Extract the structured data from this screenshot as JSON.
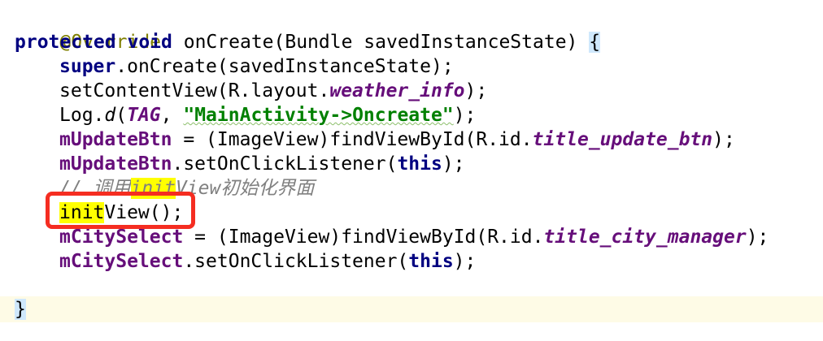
{
  "code": {
    "l1": {
      "annotation": "@Override"
    },
    "l2": {
      "kw_protected": "protected",
      "kw_void": "void",
      "signature": "onCreate(Bundle savedInstanceState)",
      "open_brace": "{"
    },
    "l3": {
      "kw_super": "super",
      "rest": ".onCreate(savedInstanceState);"
    },
    "l4": {
      "pre": "setContentView(R.layout.",
      "field": "weather_info",
      "post": ");"
    },
    "l5": {
      "pre": "Log.",
      "method": "d",
      "paren": "(",
      "tag": "TAG",
      "comma": ", ",
      "string": "\"MainActivity->Oncreate\"",
      "post": ");"
    },
    "l6": {
      "field": "mUpdateBtn",
      "mid": " = (ImageView)findViewById(R.id.",
      "id": "title_update_btn",
      "post": ");"
    },
    "l7": {
      "field": "mUpdateBtn",
      "mid": ".setOnClickListener(",
      "kw_this": "this",
      "post": ");"
    },
    "l8": {
      "comment_pre": "// 调用",
      "comment_hl": "init",
      "comment_post": "View初始化界面"
    },
    "l9": {
      "hl": "init",
      "rest": "View();"
    },
    "l10": {
      "field": "mCitySelect",
      "mid": " = (ImageView)findViewById(R.id.",
      "id": "title_city_manager",
      "post": ");"
    },
    "l11": {
      "field": "mCitySelect",
      "mid": ".setOnClickListener(",
      "kw_this": "this",
      "post": ");"
    },
    "l13": {
      "close_brace": "}"
    }
  },
  "colors": {
    "keyword": "#000080",
    "field": "#660e7a",
    "string": "#008000",
    "comment": "#808080",
    "annotation": "#808000",
    "callout": "#f52d21",
    "search_highlight": "#ffff00",
    "current_line": "#fefbe6"
  }
}
